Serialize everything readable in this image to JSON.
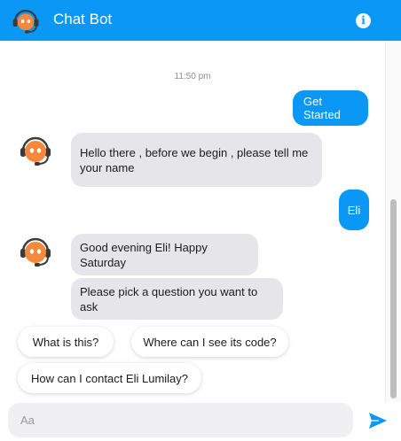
{
  "header": {
    "title": "Chat Bot",
    "bot_icon": "robot-headset-icon",
    "info_icon": "info-icon",
    "info_glyph": "i",
    "color": "#0a97f5"
  },
  "conversation": {
    "timestamp": "11:50 pm",
    "messages": [
      {
        "from": "user",
        "text": "Get Started"
      },
      {
        "from": "bot",
        "text": "Hello there , before we begin , please tell me your name"
      },
      {
        "from": "user",
        "text": "Eli"
      },
      {
        "from": "bot",
        "text": "Good evening Eli! Happy Saturday"
      },
      {
        "from": "bot",
        "text": "Please pick a question you want to ask"
      }
    ],
    "quick_replies": [
      {
        "label": "What is this?"
      },
      {
        "label": "Where can I see its code?"
      },
      {
        "label": "How can I contact Eli Lumilay?"
      }
    ]
  },
  "composer": {
    "placeholder": "Aa",
    "value": "",
    "send_icon": "send-arrow-icon"
  },
  "colors": {
    "accent": "#0a97f5",
    "bot_bubble": "#e6e6ea",
    "bot_avatar": "#f4883c"
  }
}
